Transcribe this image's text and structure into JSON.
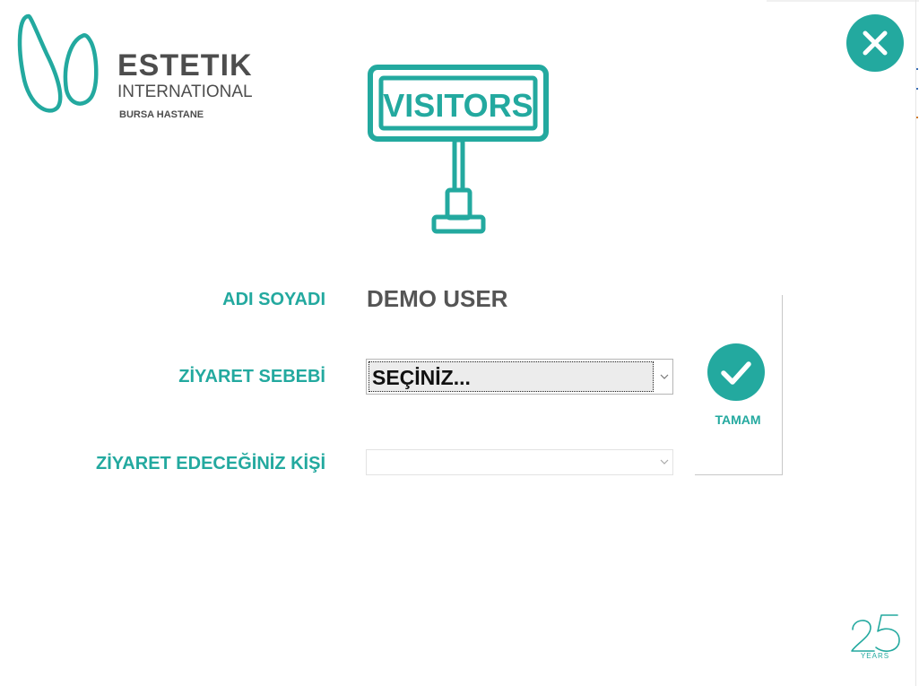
{
  "brand": {
    "title": "ESTETIK",
    "subtitle": "INTERNATIONAL",
    "location": "BURSA HASTANE",
    "accent_color": "#23a99f",
    "text_color": "#4d4d4d"
  },
  "sign": {
    "text": "VISITORS"
  },
  "form": {
    "name_label": "ADI SOYADI",
    "name_value": "DEMO USER",
    "reason_label": "ZİYARET SEBEBİ",
    "reason_selected": "SEÇİNİZ...",
    "person_label": "ZİYARET EDECEĞİNİZ KİŞİ",
    "person_selected": ""
  },
  "actions": {
    "ok_label": "TAMAM",
    "close_icon": "close-icon",
    "ok_icon": "checkmark-icon"
  },
  "badge": {
    "caption": "YEARS",
    "icon": "25-years-icon"
  }
}
